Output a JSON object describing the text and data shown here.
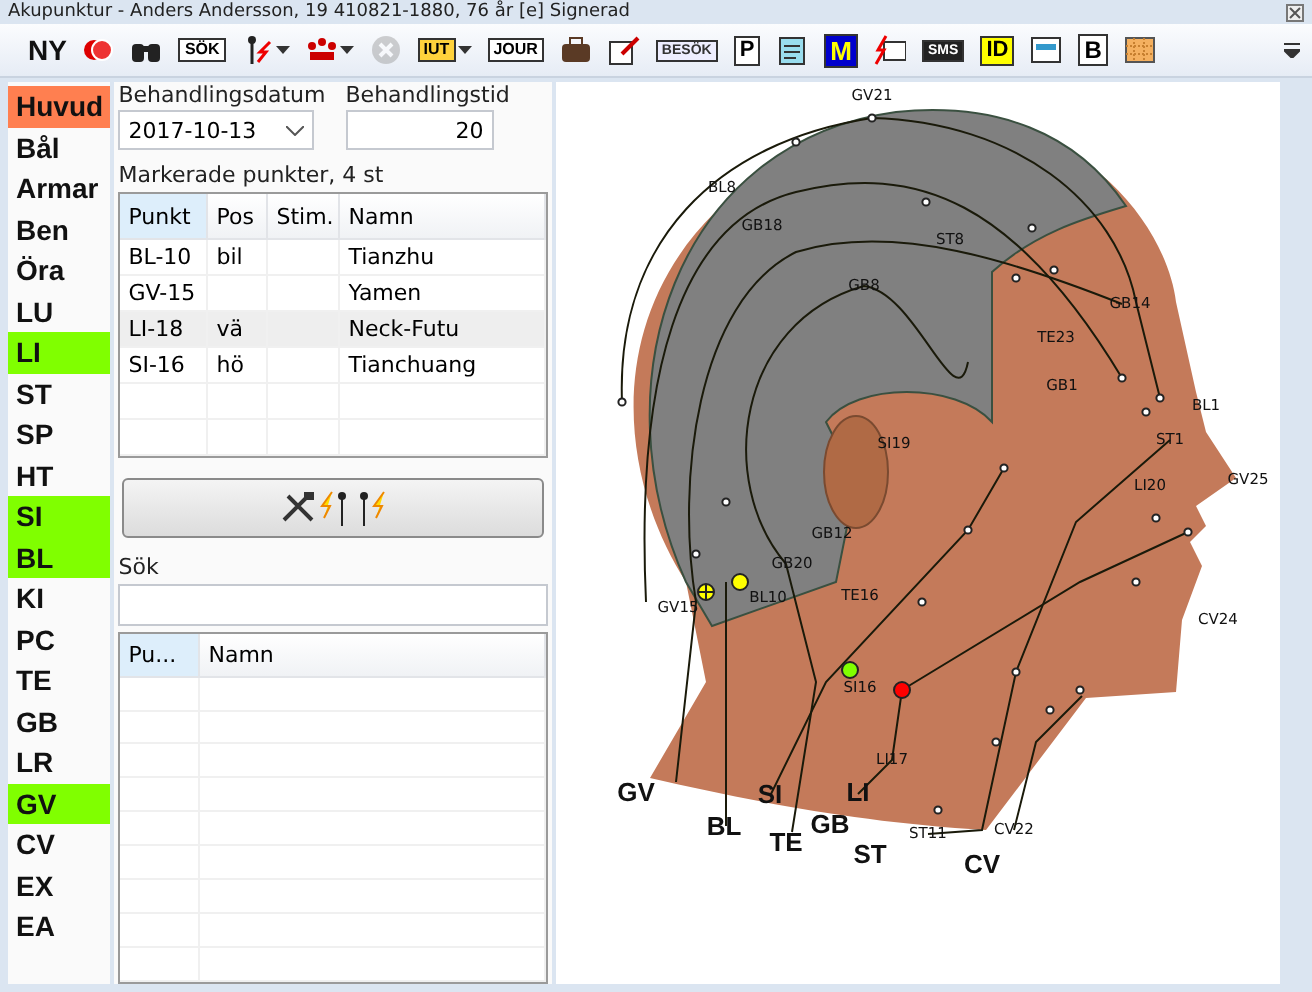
{
  "window": {
    "title": "Akupunktur - Anders Andersson, 19 410821-1880, 76 år [e] Signerad"
  },
  "toolbar": [
    {
      "kind": "text",
      "label": "NY",
      "menu": false,
      "disabled": false
    },
    {
      "kind": "icon",
      "menu": false,
      "disabled": false
    },
    {
      "kind": "icon",
      "menu": false,
      "disabled": false
    },
    {
      "kind": "badge",
      "label": "SÖK",
      "menu": false,
      "disabled": false
    },
    {
      "kind": "icon",
      "menu": true,
      "disabled": false
    },
    {
      "kind": "icon",
      "menu": true,
      "disabled": false
    },
    {
      "kind": "icon",
      "menu": false,
      "disabled": true
    },
    {
      "kind": "badge",
      "label": "IUT",
      "menu": true,
      "disabled": false
    },
    {
      "kind": "badge",
      "label": "JOUR",
      "menu": false,
      "disabled": false
    },
    {
      "kind": "icon",
      "menu": false,
      "disabled": false
    },
    {
      "kind": "icon",
      "menu": false,
      "disabled": false
    },
    {
      "kind": "badge",
      "label": "BESÖK",
      "menu": false,
      "disabled": false
    },
    {
      "kind": "badge",
      "label": "P",
      "menu": false,
      "disabled": false
    },
    {
      "kind": "icon",
      "menu": false,
      "disabled": false
    },
    {
      "kind": "badge",
      "label": "M",
      "menu": false,
      "disabled": false
    },
    {
      "kind": "icon",
      "menu": false,
      "disabled": false
    },
    {
      "kind": "badge",
      "label": "SMS",
      "menu": false,
      "disabled": false
    },
    {
      "kind": "badge",
      "label": "ID",
      "menu": false,
      "disabled": false
    },
    {
      "kind": "icon",
      "menu": false,
      "disabled": false
    },
    {
      "kind": "badge",
      "label": "B",
      "menu": false,
      "disabled": false
    },
    {
      "kind": "icon",
      "menu": false,
      "disabled": false
    }
  ],
  "nav": [
    {
      "label": "Huvud",
      "selected": true,
      "highlighted": false
    },
    {
      "label": "Bål",
      "selected": false,
      "highlighted": false
    },
    {
      "label": "Armar",
      "selected": false,
      "highlighted": false
    },
    {
      "label": "Ben",
      "selected": false,
      "highlighted": false
    },
    {
      "label": "Öra",
      "selected": false,
      "highlighted": false
    },
    {
      "label": "LU",
      "selected": false,
      "highlighted": false
    },
    {
      "label": "LI",
      "selected": false,
      "highlighted": true
    },
    {
      "label": "ST",
      "selected": false,
      "highlighted": false
    },
    {
      "label": "SP",
      "selected": false,
      "highlighted": false
    },
    {
      "label": "HT",
      "selected": false,
      "highlighted": false
    },
    {
      "label": "SI",
      "selected": false,
      "highlighted": true
    },
    {
      "label": "BL",
      "selected": false,
      "highlighted": true
    },
    {
      "label": "KI",
      "selected": false,
      "highlighted": false
    },
    {
      "label": "PC",
      "selected": false,
      "highlighted": false
    },
    {
      "label": "TE",
      "selected": false,
      "highlighted": false
    },
    {
      "label": "GB",
      "selected": false,
      "highlighted": false
    },
    {
      "label": "LR",
      "selected": false,
      "highlighted": false
    },
    {
      "label": "GV",
      "selected": false,
      "highlighted": true
    },
    {
      "label": "CV",
      "selected": false,
      "highlighted": false
    },
    {
      "label": "EX",
      "selected": false,
      "highlighted": false
    },
    {
      "label": "EA",
      "selected": false,
      "highlighted": false
    }
  ],
  "treatment": {
    "date_label": "Behandlingsdatum",
    "date": "2017-10-13",
    "time_label": "Behandlingstid",
    "time": "20"
  },
  "points_table": {
    "caption": "Markerade punkter, 4 st",
    "columns": [
      "Punkt",
      "Pos",
      "Stim.",
      "Namn"
    ],
    "rows": [
      {
        "cells": [
          "BL-10",
          "bil",
          "",
          "Tianzhu"
        ],
        "selected": false
      },
      {
        "cells": [
          "GV-15",
          "",
          "",
          "Yamen"
        ],
        "selected": false
      },
      {
        "cells": [
          "LI-18",
          "vä",
          "",
          "Neck-Futu"
        ],
        "selected": true
      },
      {
        "cells": [
          "SI-16",
          "hö",
          "",
          "Tianchuang"
        ],
        "selected": false
      }
    ]
  },
  "search": {
    "label": "Sök"
  },
  "results_table": {
    "columns": [
      "Pu...",
      "Namn"
    ]
  },
  "diagram": {
    "point_labels": [
      "GV21",
      "BL8",
      "GB18",
      "ST8",
      "GB8",
      "GB14",
      "TE23",
      "GB1",
      "BL1",
      "SI19",
      "ST1",
      "LI20",
      "GV25",
      "GB12",
      "GB20",
      "GV15",
      "BL10",
      "TE16",
      "CV24",
      "SI16",
      "LI17",
      "ST11",
      "CV22"
    ],
    "meridian_labels": [
      "GV",
      "BL",
      "SI",
      "TE",
      "GB",
      "LI",
      "ST",
      "CV"
    ],
    "markers": [
      {
        "color": "#ffff00",
        "crossed": true
      },
      {
        "color": "#ffff00",
        "crossed": false
      },
      {
        "color": "#80ff00",
        "crossed": false
      },
      {
        "color": "#ff0000",
        "crossed": false
      }
    ]
  }
}
